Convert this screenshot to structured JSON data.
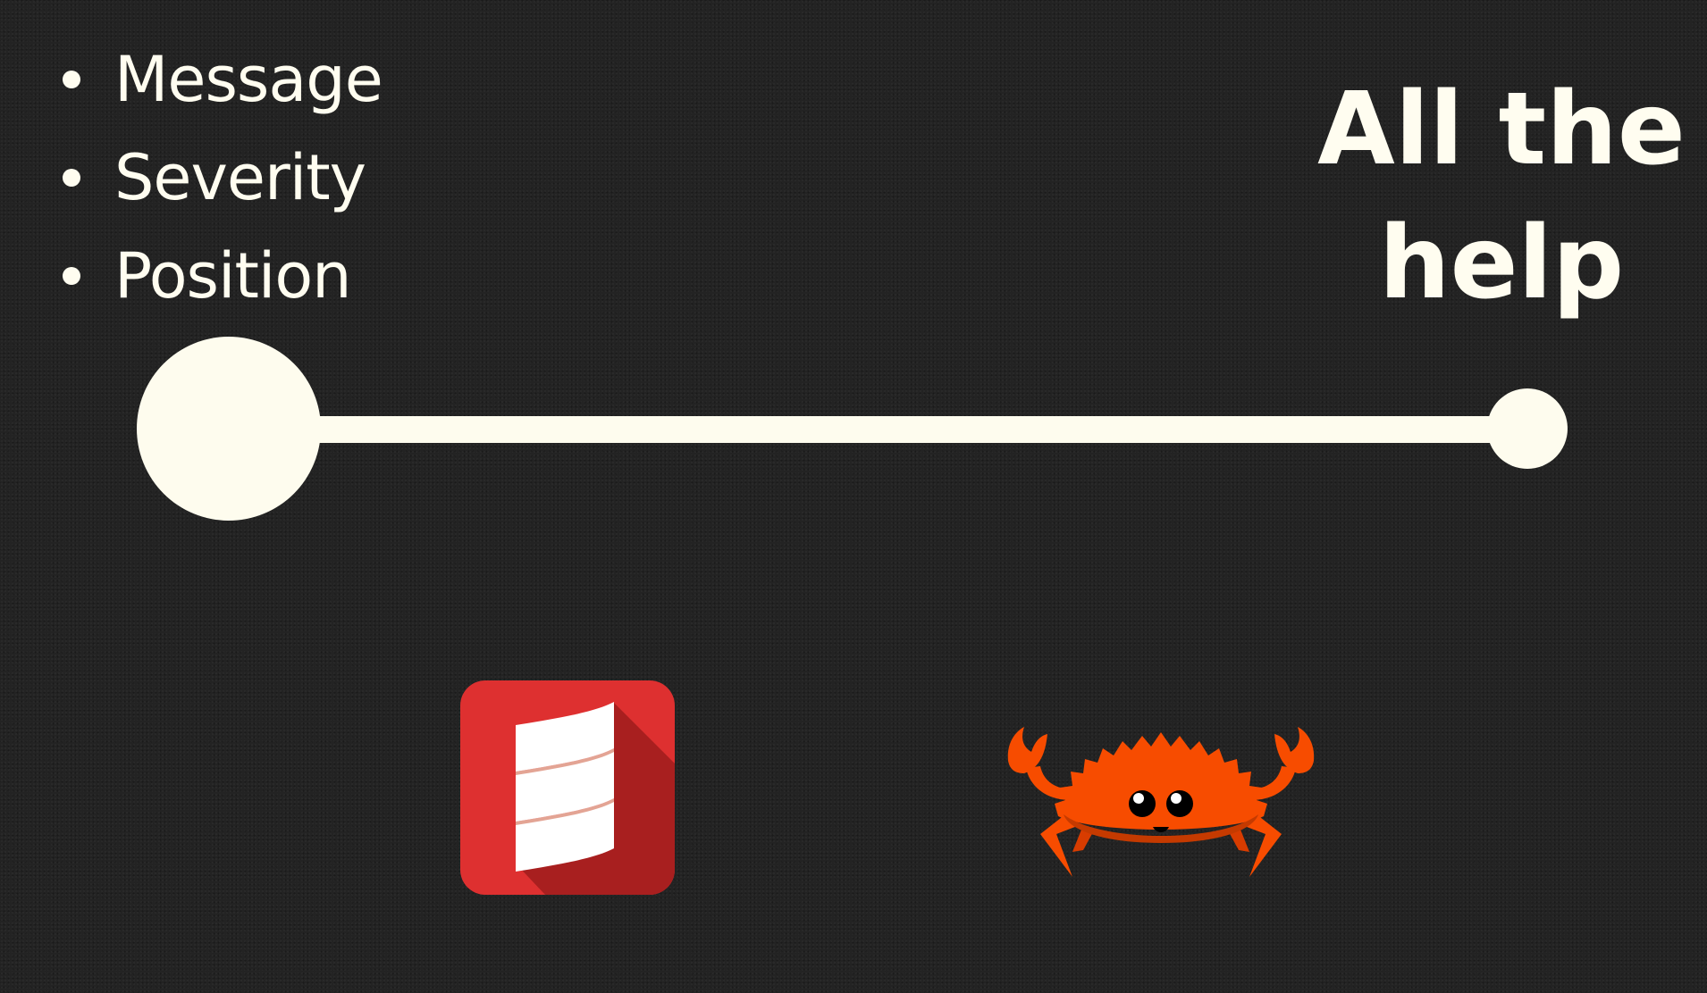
{
  "bullets": [
    {
      "text": "Message"
    },
    {
      "text": "Severity"
    },
    {
      "text": "Position"
    }
  ],
  "heading": {
    "text": "All the\nhelp"
  },
  "logos": {
    "left": "scala-logo",
    "right": "ferris-crab-logo"
  },
  "colors": {
    "background": "#232323",
    "foreground": "#fffdf0",
    "scala_red": "#de3030",
    "ferris_orange": "#f74c00"
  }
}
